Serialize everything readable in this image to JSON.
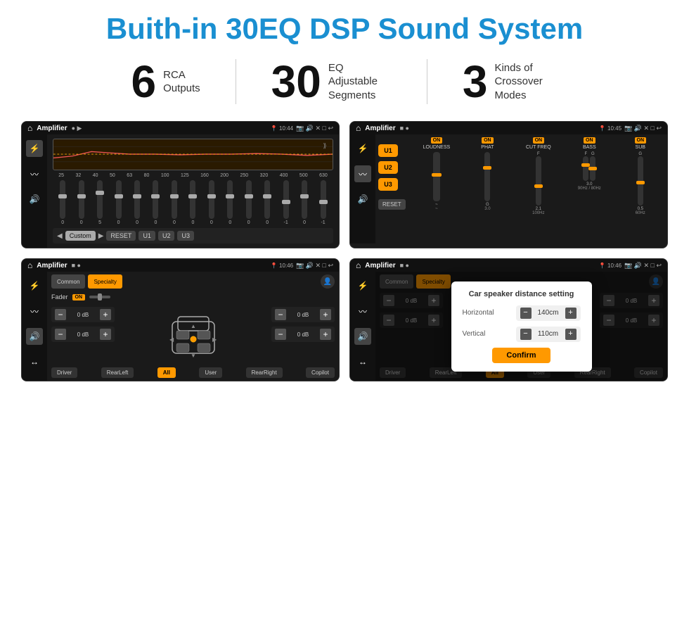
{
  "page": {
    "title": "Buith-in 30EQ DSP Sound System"
  },
  "stats": [
    {
      "num": "6",
      "text_line1": "RCA",
      "text_line2": "Outputs"
    },
    {
      "num": "30",
      "text_line1": "EQ Adjustable",
      "text_line2": "Segments"
    },
    {
      "num": "3",
      "text_line1": "Kinds of",
      "text_line2": "Crossover Modes"
    }
  ],
  "screen1": {
    "app_name": "Amplifier",
    "time": "10:44",
    "freqs": [
      "25",
      "32",
      "40",
      "50",
      "63",
      "80",
      "100",
      "125",
      "160",
      "200",
      "250",
      "320",
      "400",
      "500",
      "630"
    ],
    "preset": "Custom",
    "buttons": [
      "RESET",
      "U1",
      "U2",
      "U3"
    ]
  },
  "screen2": {
    "app_name": "Amplifier",
    "time": "10:45",
    "presets": [
      "U1",
      "U2",
      "U3"
    ],
    "controls": [
      {
        "label": "LOUDNESS",
        "on": true,
        "value": ""
      },
      {
        "label": "PHAT",
        "on": true,
        "value": "G"
      },
      {
        "label": "CUT FREQ",
        "on": true,
        "value": "F"
      },
      {
        "label": "BASS",
        "on": true,
        "value": "F G"
      },
      {
        "label": "SUB",
        "on": true,
        "value": "G"
      }
    ],
    "reset": "RESET"
  },
  "screen3": {
    "app_name": "Amplifier",
    "time": "10:46",
    "tabs": [
      "Common",
      "Specialty"
    ],
    "fader_label": "Fader",
    "fader_on": "ON",
    "speakers": {
      "top_left": "0 dB",
      "bottom_left": "0 dB",
      "top_right": "0 dB",
      "bottom_right": "0 dB"
    },
    "footer_btns": [
      "Driver",
      "RearLeft",
      "All",
      "User",
      "RearRight",
      "Copilot"
    ]
  },
  "screen4": {
    "app_name": "Amplifier",
    "time": "10:46",
    "tabs": [
      "Common",
      "Specialty"
    ],
    "dialog": {
      "title": "Car speaker distance setting",
      "horizontal_label": "Horizontal",
      "horizontal_value": "140cm",
      "vertical_label": "Vertical",
      "vertical_value": "110cm",
      "confirm_label": "Confirm"
    },
    "speakers": {
      "top_left": "0 dB",
      "bottom_left": "0 dB",
      "top_right": "0 dB",
      "bottom_right": "0 dB"
    },
    "footer_btns": [
      "Driver",
      "RearLeft",
      "All",
      "User",
      "RearRight",
      "Copilot"
    ]
  }
}
